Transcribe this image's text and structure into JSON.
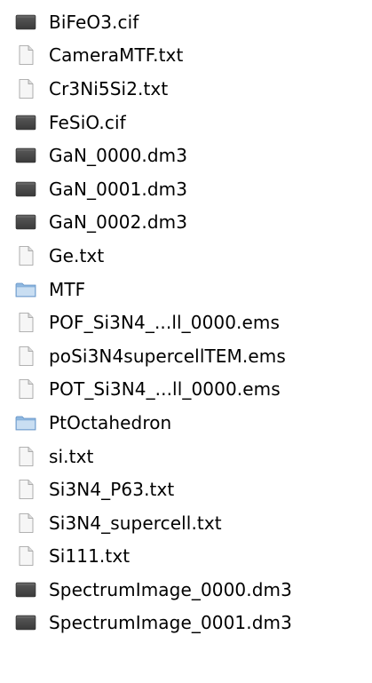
{
  "files": [
    {
      "name": "BiFeO3.cif",
      "icon": "dark-file-icon"
    },
    {
      "name": "CameraMTF.txt",
      "icon": "text-file-icon"
    },
    {
      "name": "Cr3Ni5Si2.txt",
      "icon": "text-file-icon"
    },
    {
      "name": "FeSiO.cif",
      "icon": "dark-file-icon"
    },
    {
      "name": "GaN_0000.dm3",
      "icon": "dark-file-icon"
    },
    {
      "name": "GaN_0001.dm3",
      "icon": "dark-file-icon"
    },
    {
      "name": "GaN_0002.dm3",
      "icon": "dark-file-icon"
    },
    {
      "name": "Ge.txt",
      "icon": "text-file-icon"
    },
    {
      "name": "MTF",
      "icon": "folder-icon"
    },
    {
      "name": "POF_Si3N4_...ll_0000.ems",
      "icon": "text-file-icon"
    },
    {
      "name": "poSi3N4supercellTEM.ems",
      "icon": "text-file-icon"
    },
    {
      "name": "POT_Si3N4_...ll_0000.ems",
      "icon": "text-file-icon"
    },
    {
      "name": "PtOctahedron",
      "icon": "folder-icon"
    },
    {
      "name": "si.txt",
      "icon": "text-file-icon"
    },
    {
      "name": "Si3N4_P63.txt",
      "icon": "text-file-icon"
    },
    {
      "name": "Si3N4_supercell.txt",
      "icon": "text-file-icon"
    },
    {
      "name": "Si111.txt",
      "icon": "text-file-icon"
    },
    {
      "name": "SpectrumImage_0000.dm3",
      "icon": "dark-file-icon"
    },
    {
      "name": "SpectrumImage_0001.dm3",
      "icon": "dark-file-icon"
    }
  ],
  "colors": {
    "dark_file": "#3a3a3a",
    "folder": "#8fb8e0",
    "text_file": "#f6f6f6"
  }
}
